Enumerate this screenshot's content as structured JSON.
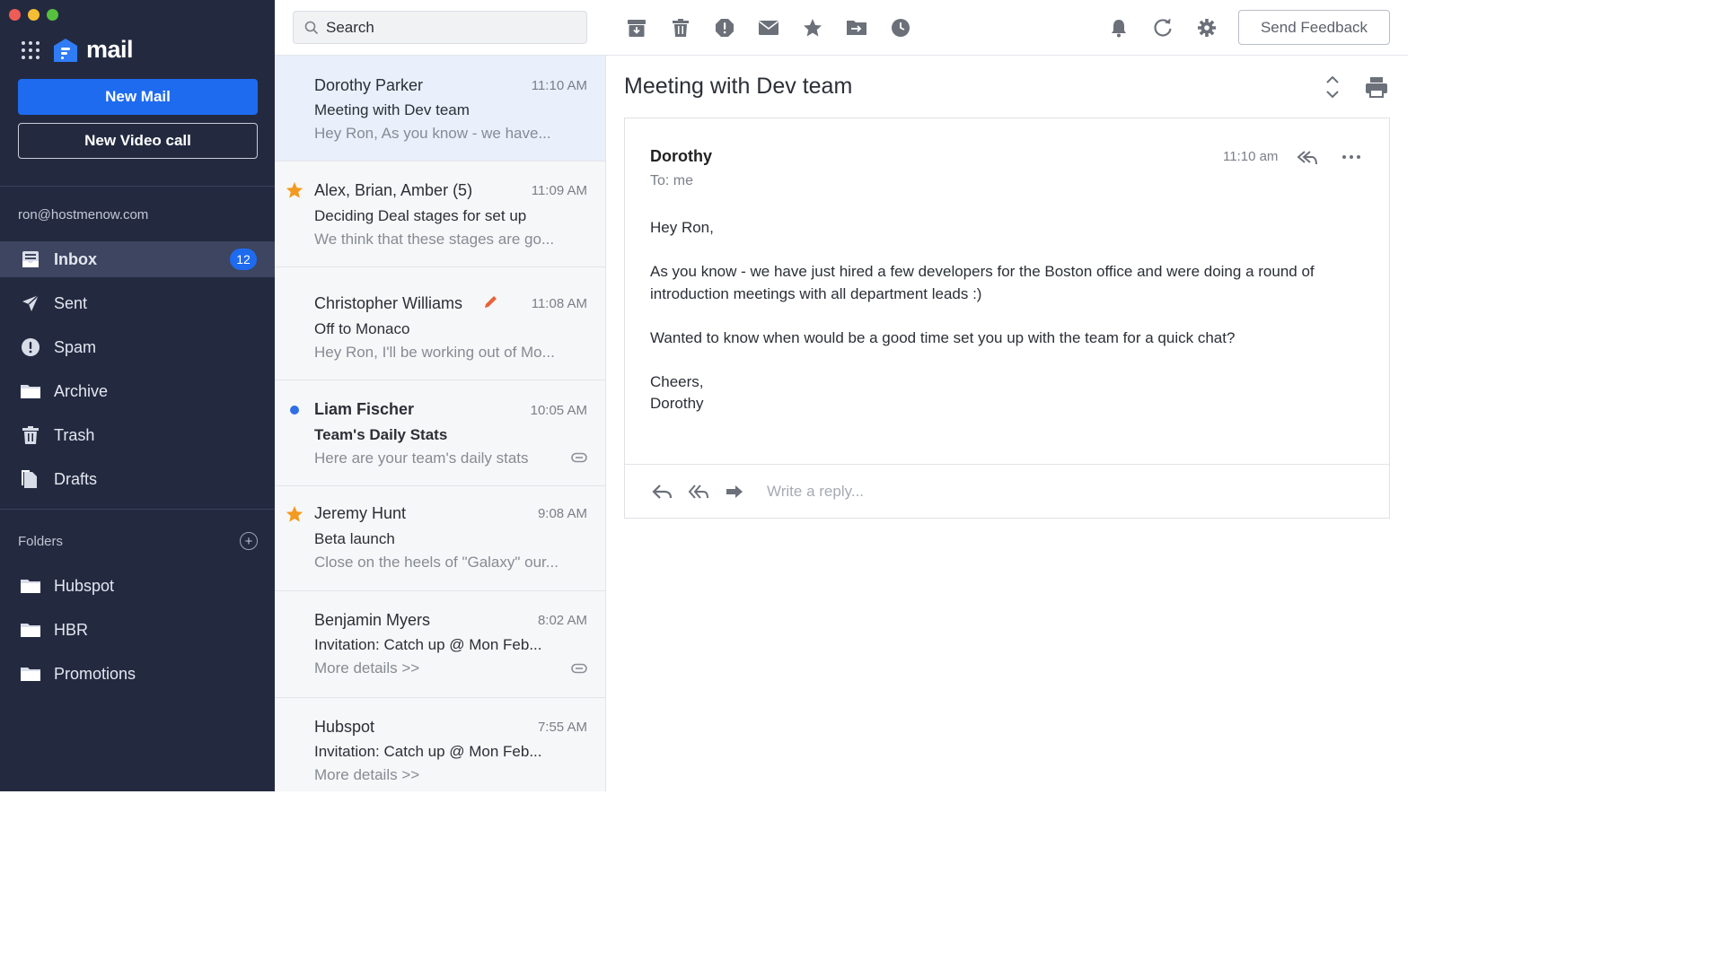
{
  "app": {
    "logo_text": "mail"
  },
  "sidebar": {
    "new_mail_label": "New Mail",
    "new_video_call_label": "New Video call",
    "account_email": "ron@hostmenow.com",
    "nav": [
      {
        "label": "Inbox",
        "icon": "inbox-icon",
        "badge": "12",
        "active": true
      },
      {
        "label": "Sent",
        "icon": "send-icon"
      },
      {
        "label": "Spam",
        "icon": "spam-icon"
      },
      {
        "label": "Archive",
        "icon": "folder-icon"
      },
      {
        "label": "Trash",
        "icon": "trash-icon"
      },
      {
        "label": "Drafts",
        "icon": "drafts-icon"
      }
    ],
    "folders_label": "Folders",
    "folders": [
      {
        "label": "Hubspot"
      },
      {
        "label": "HBR"
      },
      {
        "label": "Promotions"
      }
    ]
  },
  "toolbar": {
    "search_placeholder": "Search",
    "tools": [
      "archive-icon",
      "trash-icon",
      "spam-icon",
      "mail-icon",
      "star-icon",
      "move-folder-icon",
      "clock-icon"
    ],
    "right_tools": [
      "bell-icon",
      "refresh-icon",
      "gear-icon"
    ],
    "feedback_label": "Send Feedback"
  },
  "messages": [
    {
      "from": "Dorothy Parker",
      "time": "11:10 AM",
      "subject": "Meeting with Dev team",
      "preview": "Hey Ron, As you know - we have...",
      "selected": true
    },
    {
      "from": "Alex, Brian, Amber (5)",
      "time": "11:09 AM",
      "subject": "Deciding Deal stages for set up",
      "preview": "We think that these stages are go...",
      "starred": true
    },
    {
      "from": "Christopher Williams",
      "time": "11:08 AM",
      "subject": "Off to Monaco",
      "preview": "Hey Ron, I'll be working out of Mo...",
      "draft_icon": true
    },
    {
      "from": "Liam Fischer",
      "time": "10:05 AM",
      "subject": "Team's Daily Stats",
      "preview": "Here are your team's daily stats",
      "unread": true,
      "attachment": true
    },
    {
      "from": "Jeremy Hunt",
      "time": "9:08 AM",
      "subject": "Beta launch",
      "preview": "Close on the heels of \"Galaxy\" our...",
      "starred": true
    },
    {
      "from": "Benjamin Myers",
      "time": "8:02 AM",
      "subject": "Invitation: Catch up @ Mon Feb...",
      "preview": "More details >>",
      "attachment": true
    },
    {
      "from": "Hubspot",
      "time": "7:55 AM",
      "subject": "Invitation: Catch up @ Mon Feb...",
      "preview": "More details >>"
    }
  ],
  "reading": {
    "title": "Meeting with Dev team",
    "sender": "Dorothy",
    "to": "To: me",
    "time": "11:10 am",
    "body": [
      "Hey Ron,",
      "As you know - we have just hired a few developers for the Boston office and were doing a round of introduction meetings with all department leads :)",
      "Wanted to know when would be a good time set you up with the team for a quick chat?"
    ],
    "signoff": "Cheers,",
    "signature": "Dorothy",
    "reply_placeholder": "Write a reply..."
  },
  "colors": {
    "sidebar_bg": "#232a40",
    "accent": "#1e6bf0",
    "star": "#f39a21",
    "unread_dot": "#2f6ee6",
    "draft_pencil": "#e8633a"
  }
}
